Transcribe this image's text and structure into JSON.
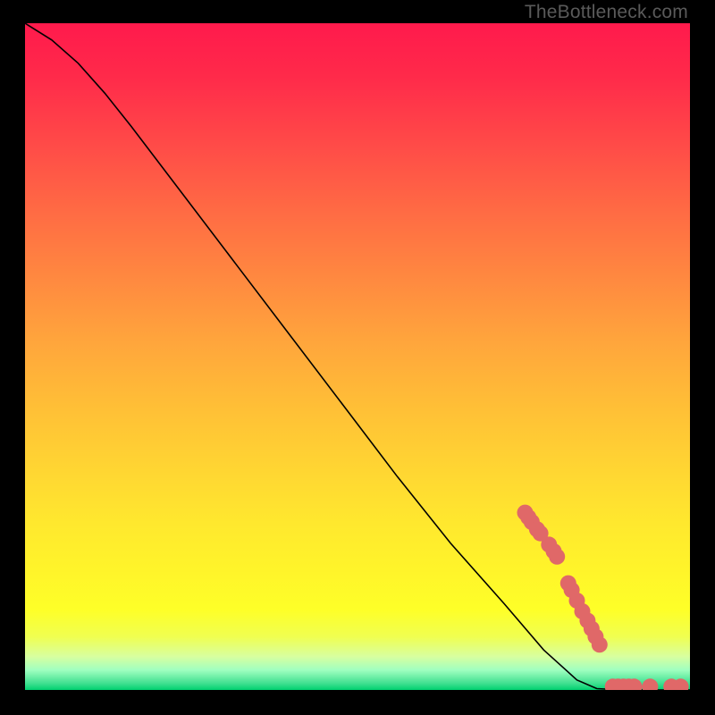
{
  "watermark": "TheBottleneck.com",
  "chart_data": {
    "type": "line",
    "title": "",
    "xlabel": "",
    "ylabel": "",
    "xlim": [
      0,
      1
    ],
    "ylim": [
      0,
      1
    ],
    "curve": {
      "name": "bottleneck-curve",
      "points": [
        {
          "x": 0.0,
          "y": 1.0
        },
        {
          "x": 0.04,
          "y": 0.975
        },
        {
          "x": 0.08,
          "y": 0.94
        },
        {
          "x": 0.12,
          "y": 0.895
        },
        {
          "x": 0.16,
          "y": 0.845
        },
        {
          "x": 0.24,
          "y": 0.74
        },
        {
          "x": 0.32,
          "y": 0.635
        },
        {
          "x": 0.4,
          "y": 0.53
        },
        {
          "x": 0.48,
          "y": 0.425
        },
        {
          "x": 0.56,
          "y": 0.32
        },
        {
          "x": 0.64,
          "y": 0.22
        },
        {
          "x": 0.72,
          "y": 0.13
        },
        {
          "x": 0.78,
          "y": 0.06
        },
        {
          "x": 0.83,
          "y": 0.015
        },
        {
          "x": 0.86,
          "y": 0.002
        },
        {
          "x": 0.9,
          "y": 0.0
        },
        {
          "x": 0.95,
          "y": 0.0
        },
        {
          "x": 1.0,
          "y": 0.0
        }
      ]
    },
    "markers": {
      "name": "highlighted-points",
      "color": "#e06868",
      "clusters": [
        {
          "cx": 0.752,
          "cy": 0.266,
          "r": 9
        },
        {
          "cx": 0.757,
          "cy": 0.259,
          "r": 9
        },
        {
          "cx": 0.762,
          "cy": 0.252,
          "r": 9
        },
        {
          "cx": 0.77,
          "cy": 0.241,
          "r": 9
        },
        {
          "cx": 0.775,
          "cy": 0.235,
          "r": 9
        },
        {
          "cx": 0.788,
          "cy": 0.218,
          "r": 9
        },
        {
          "cx": 0.795,
          "cy": 0.208,
          "r": 9
        },
        {
          "cx": 0.8,
          "cy": 0.2,
          "r": 9
        },
        {
          "cx": 0.817,
          "cy": 0.16,
          "r": 9
        },
        {
          "cx": 0.822,
          "cy": 0.15,
          "r": 9
        },
        {
          "cx": 0.83,
          "cy": 0.134,
          "r": 9
        },
        {
          "cx": 0.838,
          "cy": 0.118,
          "r": 9
        },
        {
          "cx": 0.846,
          "cy": 0.104,
          "r": 9
        },
        {
          "cx": 0.852,
          "cy": 0.092,
          "r": 9
        },
        {
          "cx": 0.858,
          "cy": 0.08,
          "r": 9
        },
        {
          "cx": 0.864,
          "cy": 0.068,
          "r": 9
        },
        {
          "cx": 0.884,
          "cy": 0.005,
          "r": 9
        },
        {
          "cx": 0.892,
          "cy": 0.005,
          "r": 9
        },
        {
          "cx": 0.9,
          "cy": 0.005,
          "r": 9
        },
        {
          "cx": 0.908,
          "cy": 0.005,
          "r": 9
        },
        {
          "cx": 0.916,
          "cy": 0.005,
          "r": 9
        },
        {
          "cx": 0.94,
          "cy": 0.005,
          "r": 9
        },
        {
          "cx": 0.972,
          "cy": 0.005,
          "r": 9
        },
        {
          "cx": 0.986,
          "cy": 0.005,
          "r": 9
        }
      ]
    }
  }
}
